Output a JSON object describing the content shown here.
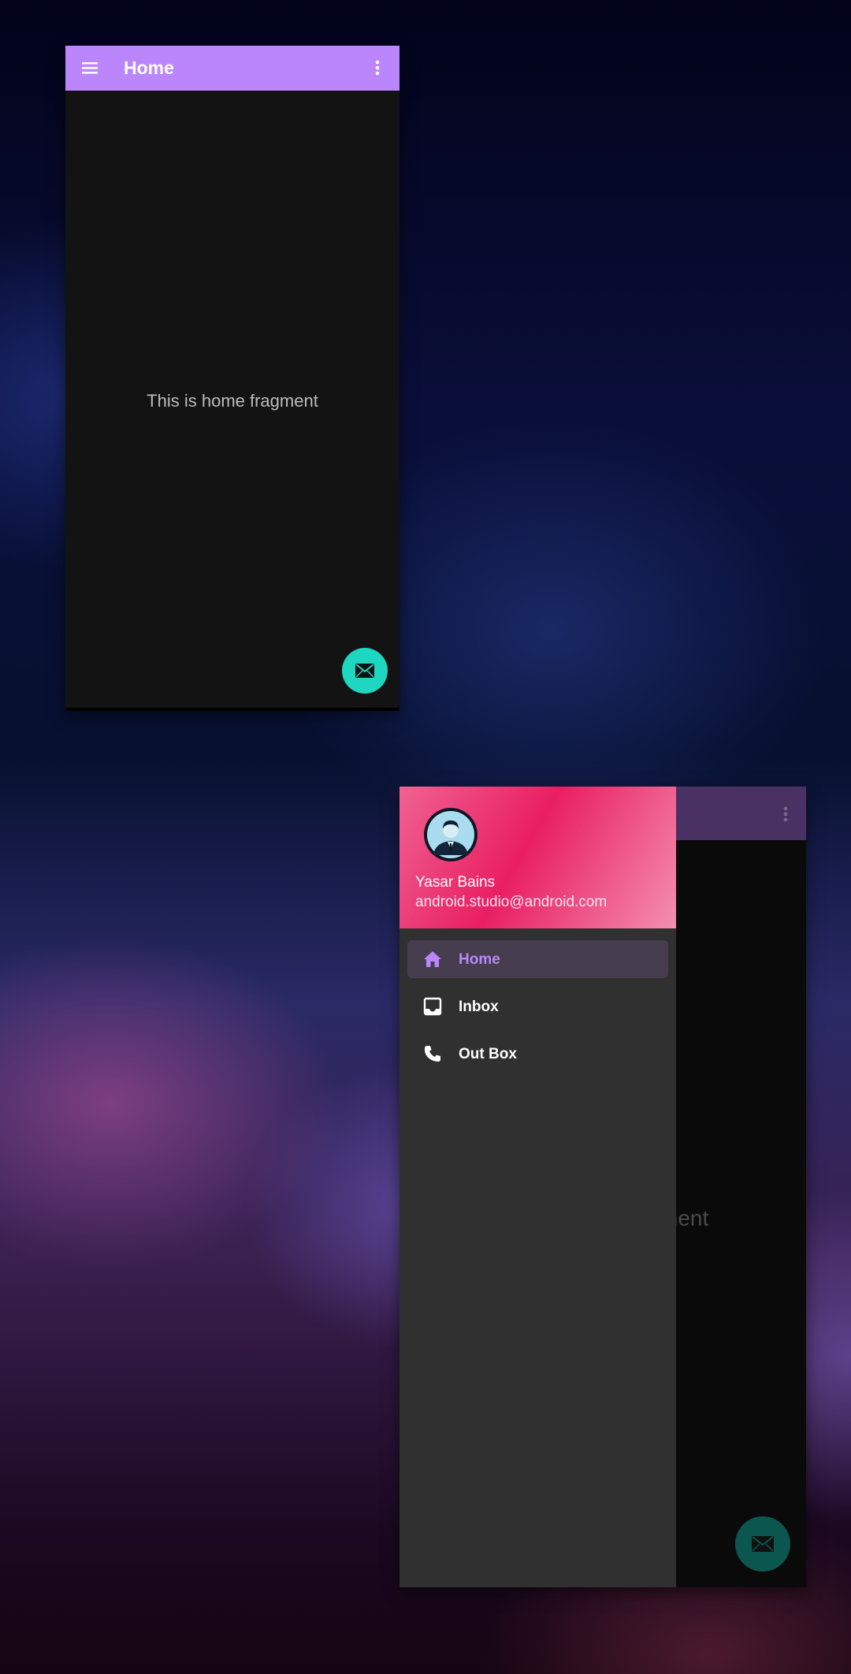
{
  "home_screen": {
    "toolbar": {
      "title": "Home",
      "menu_icon": "hamburger-menu-icon",
      "more_icon": "more-vert-icon"
    },
    "body_text": "This is home fragment",
    "fab_icon": "mail-icon",
    "colors": {
      "toolbar": "#bb86fc",
      "fab": "#1fd6c0",
      "background": "#131313"
    }
  },
  "drawer_screen": {
    "background_text_partial": "ment",
    "header": {
      "user_name": "Yasar Bains",
      "user_email": "android.studio@android.com",
      "avatar_icon": "user-avatar"
    },
    "nav_items": [
      {
        "label": "Home",
        "icon": "home-icon",
        "selected": true
      },
      {
        "label": "Inbox",
        "icon": "inbox-icon",
        "selected": false
      },
      {
        "label": "Out Box",
        "icon": "phone-icon",
        "selected": false
      }
    ],
    "colors": {
      "accent": "#bb86fc",
      "header_pink": "#e91e63",
      "drawer_bg": "#303030"
    }
  }
}
